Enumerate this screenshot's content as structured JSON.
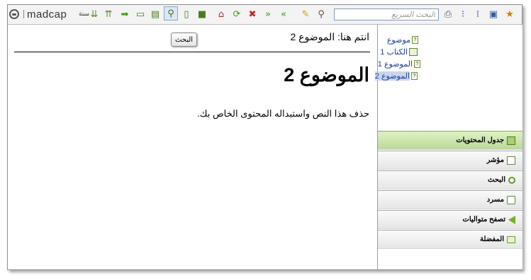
{
  "toolbar": {
    "logo_text": "madcap",
    "sr_label": "سنة",
    "search_placeholder": "البحث السريع",
    "icons": [
      "expand-all-icon",
      "collapse-all-icon",
      "forward-icon",
      "open-folder-icon",
      "comment-icon",
      "search-icon",
      "document-icon",
      "book-icon",
      "home-icon",
      "refresh-icon",
      "stop-icon",
      "next-icon",
      "previous-icon",
      "highlight-icon",
      "clear-highlight-icon",
      "print-icon",
      "toc-icon",
      "tree-icon",
      "monitor-icon",
      "favorites-icon"
    ]
  },
  "content": {
    "breadcrumb": "انتم هنا: الموضوع 2",
    "search_button": "البحث",
    "title": "الموضوع 2",
    "body": "حذف هذا النص واستبداله المحتوى الخاص بك."
  },
  "toc": {
    "items": [
      {
        "label": "موضوع"
      },
      {
        "label": "الكتاب 1"
      },
      {
        "label": "الموضوع 1"
      },
      {
        "label": "الموضوع 2"
      }
    ]
  },
  "nav_tabs": [
    {
      "label": "جدول المحتويات"
    },
    {
      "label": "مؤشر"
    },
    {
      "label": "البحث"
    },
    {
      "label": "مسرد"
    },
    {
      "label": "تصفح متواليات"
    },
    {
      "label": "المفضلة"
    }
  ]
}
